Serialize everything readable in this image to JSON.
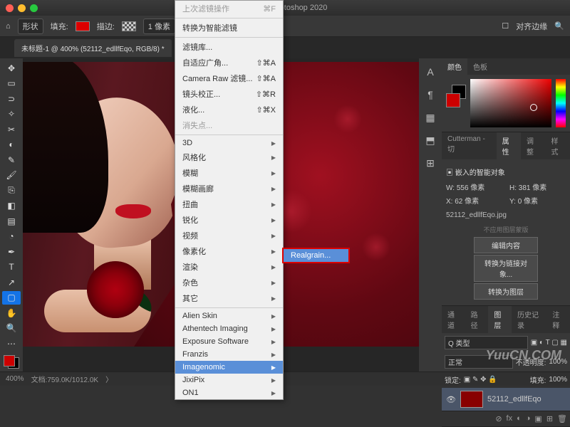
{
  "window": {
    "title": "otoshop 2020"
  },
  "optionbar": {
    "shape_label": "形状",
    "fill_label": "填充:",
    "stroke_label": "描边:",
    "stroke_width": "1 像素",
    "align_label": "对齐边缘"
  },
  "doc_tab": "未标题-1 @ 400% (52112_edllfEqo, RGB/8) *",
  "filter_menu": {
    "last": "上次滤镜操作",
    "last_key": "⌘F",
    "convert": "转换为智能滤镜",
    "gallery": "滤镜库...",
    "adaptive": "自适应广角...",
    "adaptive_key": "⇧⌘A",
    "camera_raw": "Camera Raw 滤镜...",
    "camera_raw_key": "⇧⌘A",
    "lens": "镜头校正...",
    "lens_key": "⇧⌘R",
    "liquify": "液化...",
    "liquify_key": "⇧⌘X",
    "vanish": "消失点...",
    "cat_3d": "3D",
    "cat_stylize": "风格化",
    "cat_blur": "模糊",
    "cat_blur_gallery": "模糊画廊",
    "cat_distort": "扭曲",
    "cat_sharpen": "锐化",
    "cat_video": "视频",
    "cat_pixelate": "像素化",
    "cat_render": "渲染",
    "cat_noise": "杂色",
    "cat_other": "其它",
    "alien": "Alien Skin",
    "athentech": "Athentech Imaging",
    "exposure": "Exposure Software",
    "franzis": "Franzis",
    "imagenomic": "Imagenomic",
    "jixipix": "JixiPix",
    "on1": "ON1"
  },
  "submenu": {
    "item": "Realgrain..."
  },
  "panels": {
    "color_tab": "颜色",
    "swatch_tab": "色板",
    "cutter_tab": "Cutterman - 切",
    "props_tab": "属性",
    "adjust_tab": "调整",
    "styles_tab": "样式",
    "smartobj": "嵌入的智能对象",
    "w_label": "W:",
    "w_val": "556 像素",
    "h_label": "H:",
    "h_val": "381 像素",
    "x_label": "X:",
    "x_val": "62 像素",
    "y_label": "Y:",
    "y_val": "0 像素",
    "filename": "52112_edllfEqo.jpg",
    "noedit": "不应用图层蒙版",
    "btn_edit": "编辑内容",
    "btn_convert": "转换为链接对象...",
    "btn_layers": "转换为图层",
    "ch_tab": "通道",
    "paths_tab": "路径",
    "layers_tab": "图层",
    "history_tab": "历史记录",
    "comments_tab": "注释",
    "kind": "Q 类型",
    "blend": "正常",
    "opacity_label": "不透明度:",
    "opacity": "100%",
    "lock_label": "锁定:",
    "fill_label": "填充:",
    "fill": "100%",
    "layer_name": "52112_edllfEqo"
  },
  "statusbar": {
    "zoom": "400%",
    "docsize": "文档:759.0K/1012.0K"
  },
  "watermark": "YuuCN.COM"
}
